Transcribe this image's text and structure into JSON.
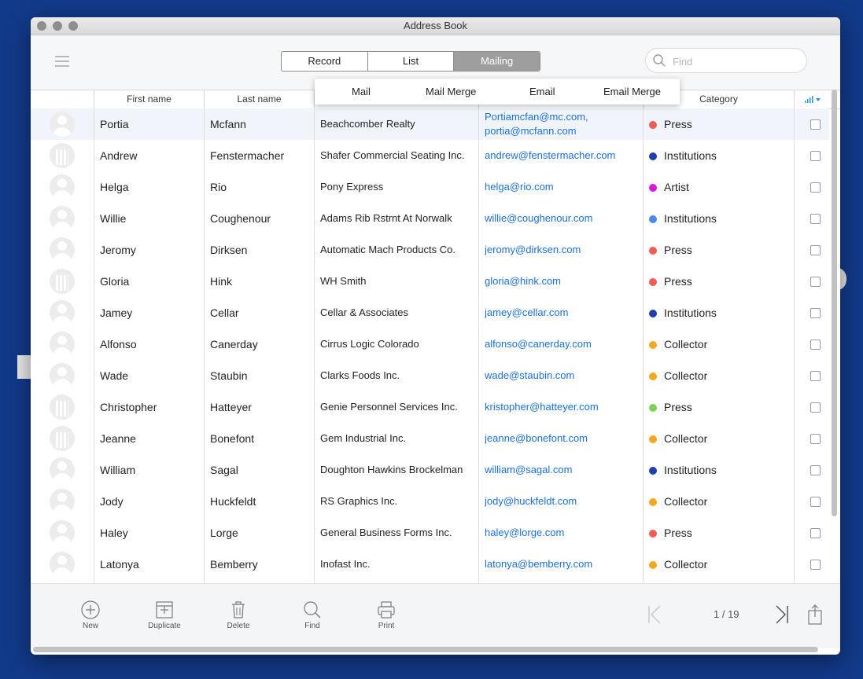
{
  "window": {
    "title": "Address Book"
  },
  "views": {
    "tabs": [
      "Record",
      "List",
      "Mailing"
    ],
    "active": "Mailing"
  },
  "search": {
    "placeholder": "Find"
  },
  "mailing_menu": [
    "Mail",
    "Mail Merge",
    "Email",
    "Email Merge"
  ],
  "columns": {
    "first_name": "First name",
    "last_name": "Last name",
    "category": "Category"
  },
  "category_colors": {
    "Press": "#f25c54",
    "Institutions": "#1f3fae",
    "Artist": "#d818d8",
    "Collector": "#f5a623",
    "Institutions-light": "#4a8af0",
    "Press-green": "#7ed05a"
  },
  "rows": [
    {
      "first": "Portia",
      "last": "Mcfann",
      "company": "Beachcomber Realty",
      "email": "Portiamcfan@mc.com,",
      "email2": "portia@mcfann.com",
      "category": "Press",
      "color": "#f25c54",
      "avatar": "person"
    },
    {
      "first": "Andrew",
      "last": "Fenstermacher",
      "company": "Shafer Commercial Seating Inc.",
      "email": "andrew@fenstermacher.com",
      "category": "Institutions",
      "color": "#1f3fae",
      "avatar": "building"
    },
    {
      "first": "Helga",
      "last": "Rio",
      "company": "Pony Express",
      "email": "helga@rio.com",
      "category": "Artist",
      "color": "#d818d8",
      "avatar": "person"
    },
    {
      "first": "Willie",
      "last": "Coughenour",
      "company": "Adams Rib Rstrnt At Norwalk",
      "email": "willie@coughenour.com",
      "category": "Institutions",
      "color": "#4a8af0",
      "avatar": "person"
    },
    {
      "first": "Jeromy",
      "last": "Dirksen",
      "company": "Automatic Mach Products Co.",
      "email": "jeromy@dirksen.com",
      "category": "Press",
      "color": "#f25c54",
      "avatar": "person"
    },
    {
      "first": "Gloria",
      "last": "Hink",
      "company": "WH Smith",
      "email": "gloria@hink.com",
      "category": "Press",
      "color": "#f25c54",
      "avatar": "building"
    },
    {
      "first": "Jamey",
      "last": "Cellar",
      "company": "Cellar & Associates",
      "email": "jamey@cellar.com",
      "category": "Institutions",
      "color": "#1f3fae",
      "avatar": "person"
    },
    {
      "first": "Alfonso",
      "last": "Canerday",
      "company": "Cirrus Logic Colorado",
      "email": "alfonso@canerday.com",
      "category": "Collector",
      "color": "#f5a623",
      "avatar": "person"
    },
    {
      "first": "Wade",
      "last": "Staubin",
      "company": "Clarks Foods Inc.",
      "email": "wade@staubin.com",
      "category": "Collector",
      "color": "#f5a623",
      "avatar": "person"
    },
    {
      "first": "Christopher",
      "last": "Hatteyer",
      "company": "Genie Personnel Services Inc.",
      "email": "kristopher@hatteyer.com",
      "category": "Press",
      "color": "#7ed05a",
      "avatar": "building"
    },
    {
      "first": "Jeanne",
      "last": "Bonefont",
      "company": "Gem Industrial Inc.",
      "email": "jeanne@bonefont.com",
      "category": "Collector",
      "color": "#f5a623",
      "avatar": "building"
    },
    {
      "first": "William",
      "last": "Sagal",
      "company": "Doughton Hawkins Brockelman",
      "email": "william@sagal.com",
      "category": "Institutions",
      "color": "#1f3fae",
      "avatar": "person"
    },
    {
      "first": "Jody",
      "last": "Huckfeldt",
      "company": "RS Graphics Inc.",
      "email": "jody@huckfeldt.com",
      "category": "Collector",
      "color": "#f5a623",
      "avatar": "person"
    },
    {
      "first": "Haley",
      "last": "Lorge",
      "company": "General Business Forms Inc.",
      "email": "haley@lorge.com",
      "category": "Press",
      "color": "#f25c54",
      "avatar": "person"
    },
    {
      "first": "Latonya",
      "last": "Bemberry",
      "company": "Inofast Inc.",
      "email": "latonya@bemberry.com",
      "category": "Collector",
      "color": "#f5a623",
      "avatar": "person"
    }
  ],
  "footer": {
    "new": "New",
    "duplicate": "Duplicate",
    "delete": "Delete",
    "find": "Find",
    "print": "Print"
  },
  "pager": {
    "text": "1 / 19"
  }
}
